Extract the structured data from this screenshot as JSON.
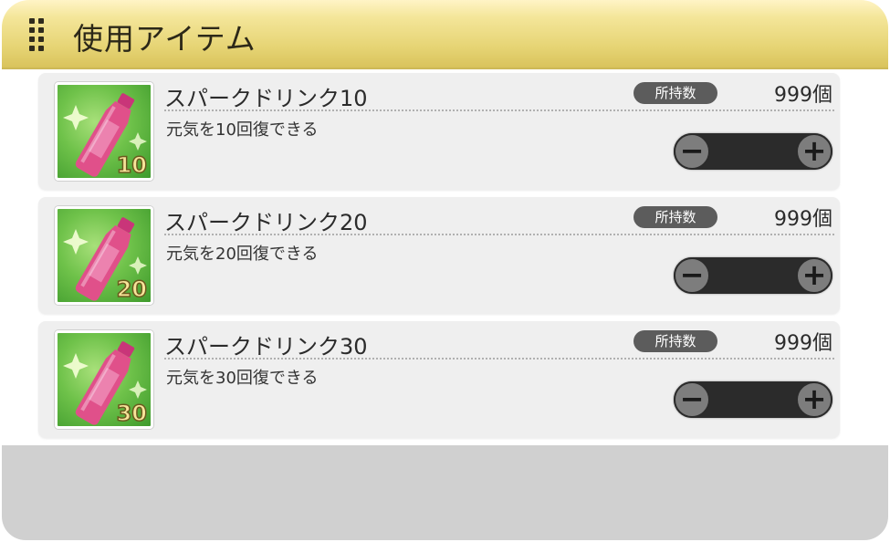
{
  "header": {
    "title": "使用アイテム"
  },
  "items": [
    {
      "name": "スパークドリンク10",
      "description": "元気を10回復できる",
      "badge": "所持数",
      "count": "999個",
      "icon_number": "10",
      "quantity": ""
    },
    {
      "name": "スパークドリンク20",
      "description": "元気を20回復できる",
      "badge": "所持数",
      "count": "999個",
      "icon_number": "20",
      "quantity": ""
    },
    {
      "name": "スパークドリンク30",
      "description": "元気を30回復できる",
      "badge": "所持数",
      "count": "999個",
      "icon_number": "30",
      "quantity": ""
    }
  ],
  "stepper": {
    "minus": "−",
    "plus": "+"
  },
  "colors": {
    "header": "#e6d474",
    "stepper": "#2b2b2b",
    "bottle": "#e0508a",
    "thumb_bg": "#6fc24a"
  },
  "icons": {
    "grip": "drag-handle-icon",
    "item": "energy-drink-bottle-icon"
  }
}
